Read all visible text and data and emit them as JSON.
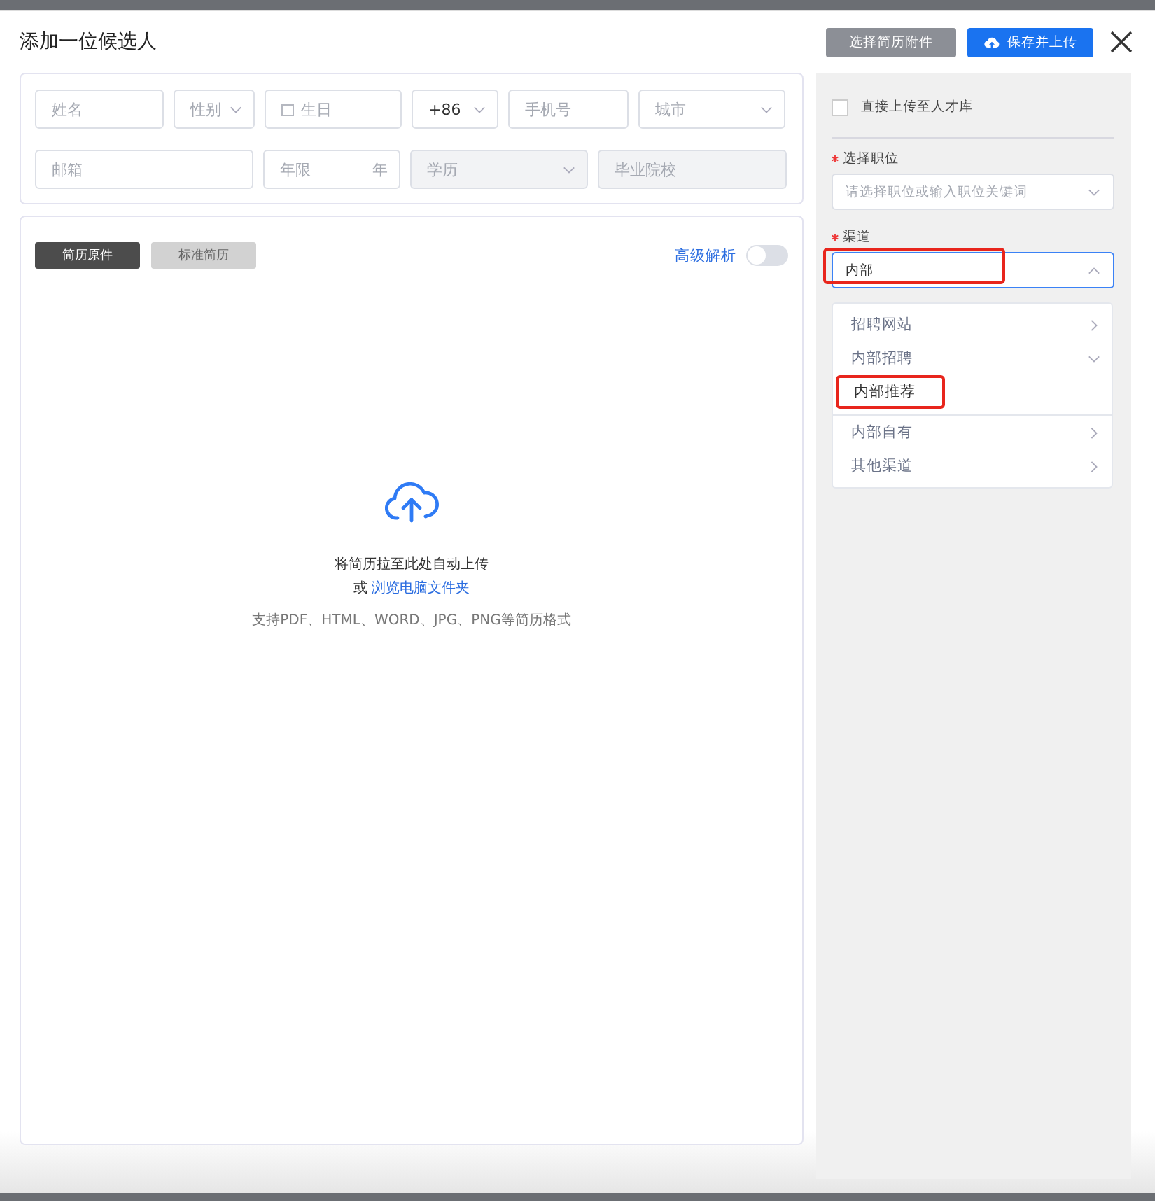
{
  "dialog": {
    "title": "添加一位候选人",
    "buttons": [
      {
        "label": "选择简历附件",
        "kind": "secondary"
      },
      {
        "label": "保存并上传",
        "kind": "primary"
      }
    ]
  },
  "form": {
    "first_line": [
      {
        "kind": "text",
        "placeholder": "姓名",
        "disabled": false
      },
      {
        "kind": "select",
        "placeholder": "性别",
        "disabled": false
      },
      {
        "kind": "date",
        "placeholder": "生日",
        "disabled": false
      },
      {
        "kind": "select",
        "value": "+86",
        "disabled": false
      },
      {
        "kind": "text",
        "placeholder": "手机号",
        "disabled": false
      },
      {
        "kind": "select",
        "placeholder": "城市",
        "disabled": false
      }
    ],
    "second_line": [
      {
        "kind": "text",
        "placeholder": "邮箱",
        "disabled": false
      },
      {
        "kind": "suffix",
        "placeholder": "年限",
        "suffix": "年",
        "disabled": false
      },
      {
        "kind": "select",
        "placeholder": "学历",
        "disabled": true
      },
      {
        "kind": "text",
        "placeholder": "毕业院校",
        "disabled": true
      }
    ]
  },
  "upload": {
    "tabs": [
      {
        "label": "简历原件",
        "selected": true
      },
      {
        "label": "标准简历",
        "selected": false
      }
    ],
    "advanced": {
      "label": "高级解析",
      "on": false
    },
    "hint": "将简历拉至此处自动上传",
    "or": "或",
    "link": "浏览电脑文件夹",
    "formats": "支持PDF、HTML、WORD、JPG、PNG等简历格式"
  },
  "side": {
    "direct_upload": {
      "label": "直接上传至人才库",
      "checked": false
    },
    "position": {
      "label": "选择职位",
      "required": true,
      "placeholder": "请选择职位或输入职位关键词"
    },
    "channel": {
      "label": "渠道",
      "required": true,
      "value": "内部",
      "highlighted": true,
      "options": [
        {
          "label": "招聘网站",
          "expanded": false
        },
        {
          "label": "内部招聘",
          "expanded": true,
          "children": [
            {
              "label": "内部推荐",
              "highlighted": true
            }
          ]
        },
        {
          "label": "内部自有",
          "expanded": false
        },
        {
          "label": "其他渠道",
          "expanded": false
        }
      ]
    }
  }
}
